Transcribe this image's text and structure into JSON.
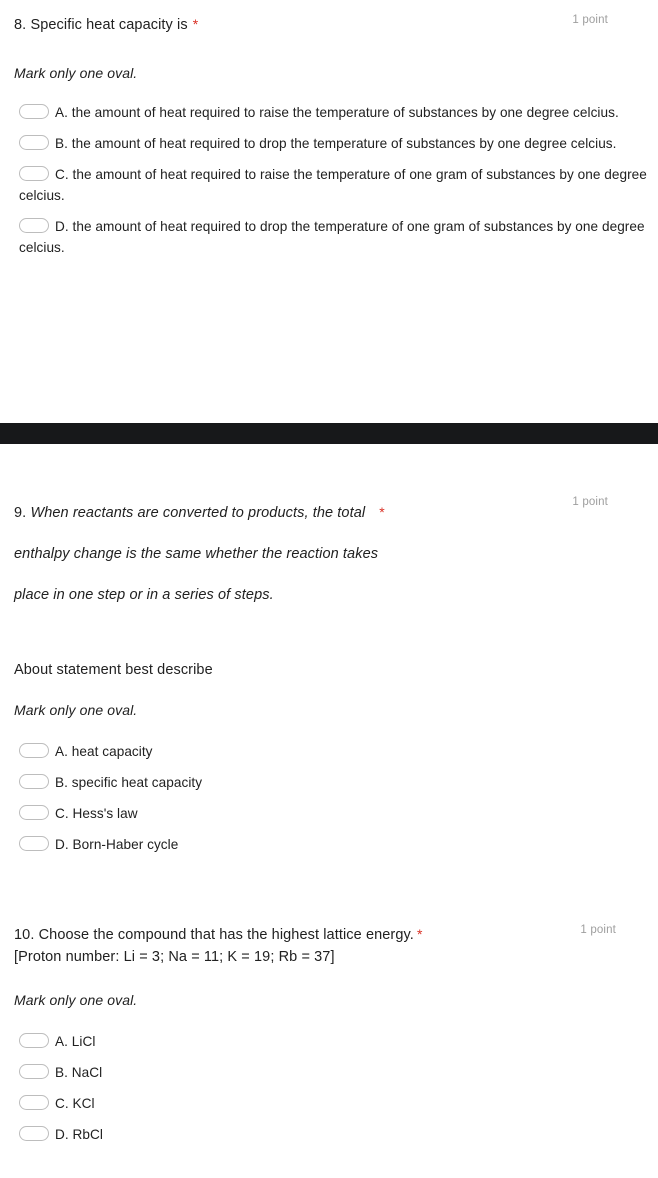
{
  "form": {
    "type": "quiz-form",
    "background": "#ffffff",
    "text_color": "#212121",
    "required_marker_color": "#d93025",
    "points_color": "#9e9e9e",
    "oval_border_color": "#bdbdbd",
    "separator_color": "#17181a"
  },
  "questions": [
    {
      "number": "8.",
      "title": "Specific heat capacity is",
      "required_marker": "*",
      "points": "1 point",
      "instruction": "Mark only one oval.",
      "options": [
        {
          "label": "A. the amount of heat required to raise the temperature of substances by one degree celcius."
        },
        {
          "label": "B. the amount of heat required to drop the temperature of substances by one degree celcius."
        },
        {
          "label": "C. the amount of heat required to raise the temperature of one gram of substances by one degree celcius."
        },
        {
          "label": "D. the amount of heat required to drop the temperature of one gram of substances by one degree celcius."
        }
      ]
    },
    {
      "number": "9.",
      "statement_lines": [
        "When reactants are converted to products, the total",
        "enthalpy change is the same whether the reaction takes",
        "place in one step or in a series of steps."
      ],
      "required_marker": "*",
      "points": "1 point",
      "sub_prompt": "About statement best describe",
      "instruction": "Mark only one oval.",
      "options": [
        {
          "label": "A. heat capacity"
        },
        {
          "label": "B. specific heat capacity"
        },
        {
          "label": "C. Hess's law"
        },
        {
          "label": "D. Born-Haber cycle"
        }
      ]
    },
    {
      "number": "10.",
      "title": "Choose the compound that has the highest lattice energy.",
      "required_marker": "*",
      "points": "1 point",
      "subtitle": "[Proton number:  Li = 3;  Na = 11;  K = 19;  Rb = 37]",
      "instruction": "Mark only one oval.",
      "options": [
        {
          "label": "A. LiCl"
        },
        {
          "label": "B. NaCl"
        },
        {
          "label": "C. KCl"
        },
        {
          "label": "D. RbCl"
        }
      ]
    }
  ]
}
